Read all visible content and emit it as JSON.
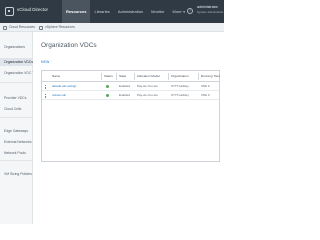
{
  "header": {
    "app_title": "vCloud Director",
    "nav": [
      {
        "label": "Resources",
        "active": true
      },
      {
        "label": "Libraries",
        "active": false
      },
      {
        "label": "Administration",
        "active": false
      },
      {
        "label": "Monitor",
        "active": false
      },
      {
        "label": "More",
        "active": false
      }
    ],
    "help_label": "?",
    "user": {
      "name": "administrator",
      "role": "System Administrator"
    }
  },
  "subbar": {
    "items": [
      "Cloud Resources",
      "vSphere Resources"
    ]
  },
  "sidebar": {
    "items": [
      {
        "label": "Organizations",
        "active": false
      },
      {
        "label": "Organization VDCs",
        "active": true
      },
      {
        "label": "Organization VDC Templates",
        "active": false
      },
      {
        "label": "Provider VDCs",
        "active": false
      },
      {
        "label": "Cloud Cells",
        "active": false
      },
      {
        "label": "Edge Gateways",
        "active": false
      },
      {
        "label": "External Networks",
        "active": false
      },
      {
        "label": "Network Pools",
        "active": false
      },
      {
        "label": "VM Sizing Policies",
        "active": false
      }
    ]
  },
  "main": {
    "title": "Organization VDCs",
    "new_label": "NEW",
    "columns": [
      "Name",
      "Status",
      "State",
      "Allocation Model",
      "Organization",
      "Running Tiers"
    ],
    "rows": [
      {
        "name": "default-vdc-swingt",
        "status": "",
        "state": "Enabled",
        "allocation": "Pay-As-You-Go",
        "organization": "SYTT-tacDey",
        "tiers": "VMs 0"
      },
      {
        "name": "nobod-vdc",
        "status": "",
        "state": "Enabled",
        "allocation": "Pay-As-You-Go",
        "organization": "SYTT-tacDey",
        "tiers": "VMs 0"
      }
    ]
  },
  "colors": {
    "header_bg": "#2f3a44",
    "link": "#1f6fb2",
    "status_ok": "#5aa65a"
  }
}
